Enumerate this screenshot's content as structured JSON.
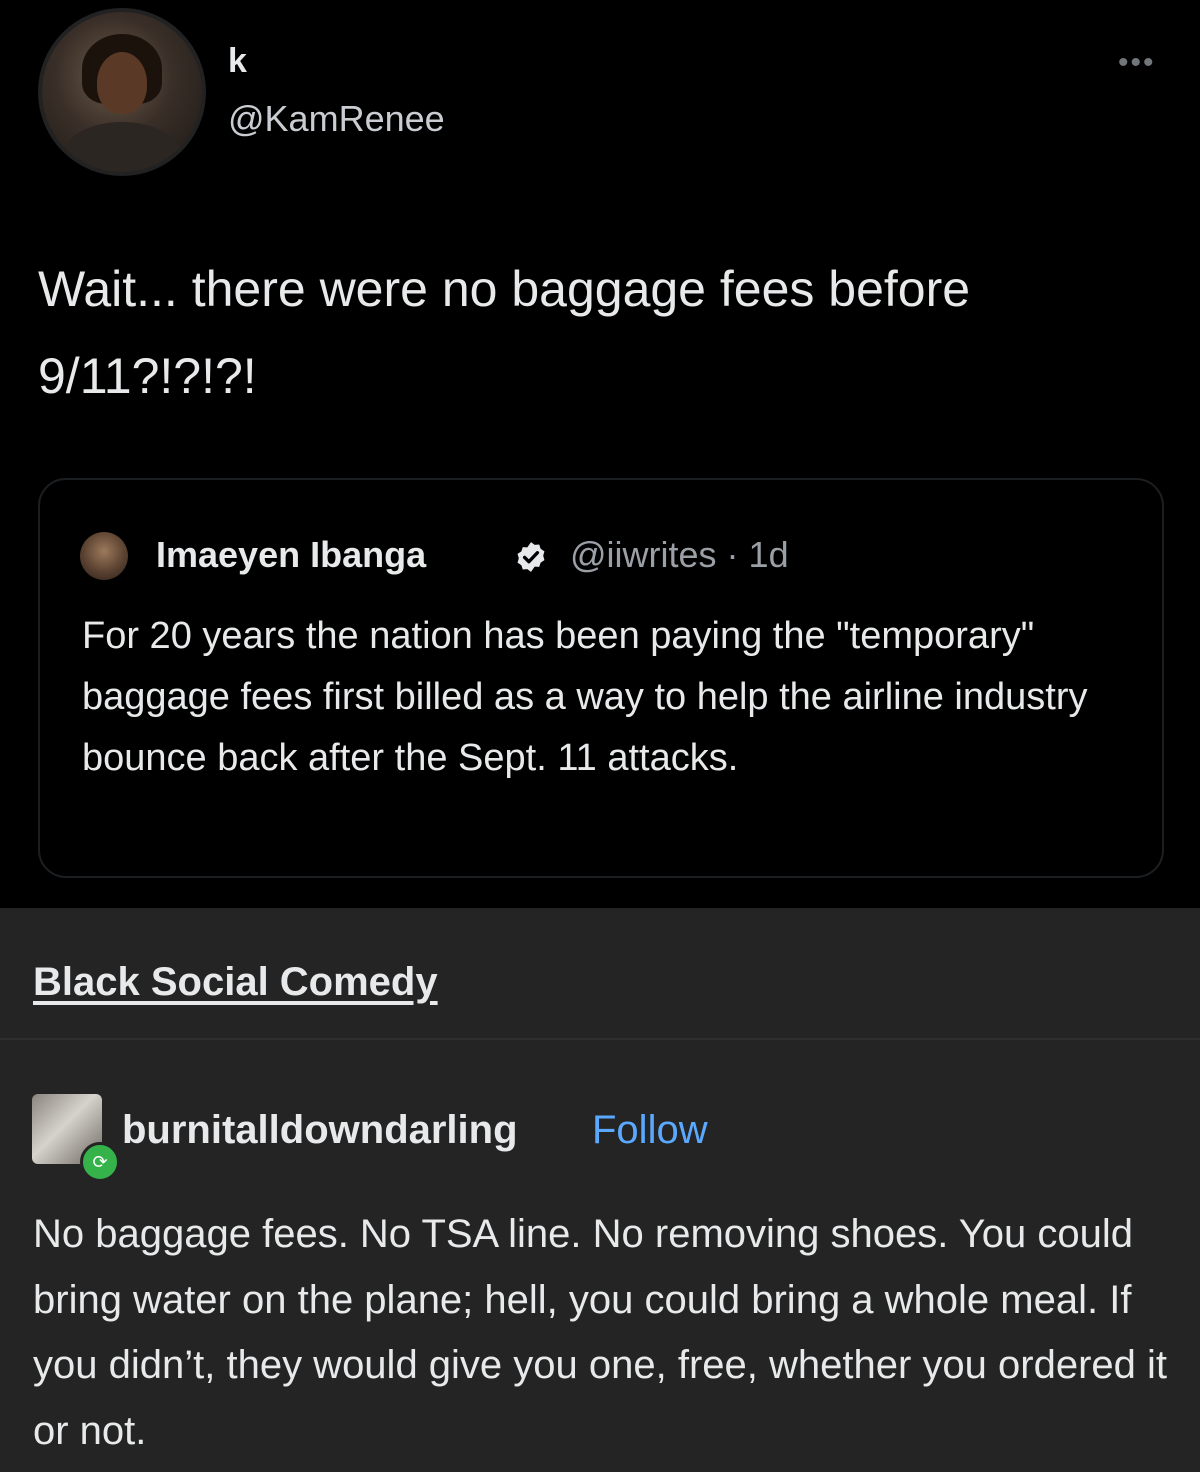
{
  "tweet": {
    "display_name": "k",
    "handle": "@KamRenee",
    "more_icon": "more-icon",
    "text": "Wait... there were no baggage fees before 9/11?!?!?!",
    "quote": {
      "name": "Imaeyen Ibanga",
      "verified_icon": "verified-icon",
      "handle_time": "@iiwrites · 1d",
      "text": "For 20 years the nation has been paying the \"temporary\" baggage fees first billed as a way to help the airline industry bounce back after the Sept. 11 attacks."
    }
  },
  "tumblr": {
    "source": "Black Social Comedy",
    "username": "burnitalldowndarling",
    "follow_label": "Follow",
    "text": "No baggage fees. No TSA line. No removing shoes. You could bring water on the plane; hell, you could bring a whole meal. If you didn’t, they would give you one, free, whether you ordered it or not.",
    "colors": {
      "follow": "#5aa9ff",
      "reblog_badge": "#35b34a",
      "background": "#242424"
    }
  }
}
